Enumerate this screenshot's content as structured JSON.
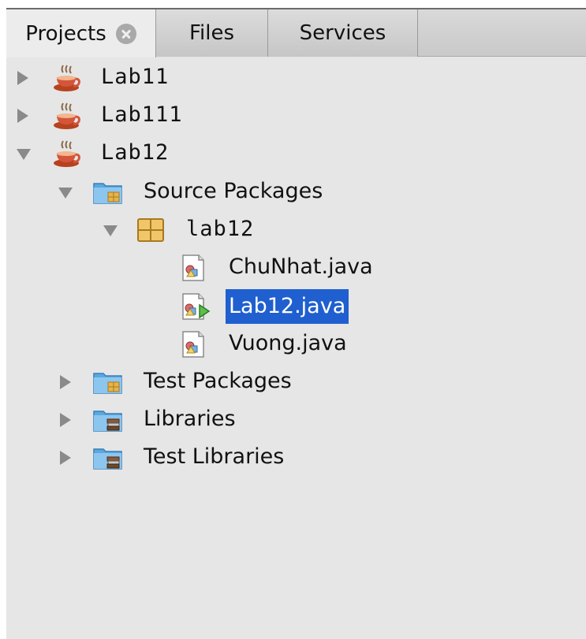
{
  "tabs": [
    {
      "label": "Projects",
      "active": true,
      "has_close": true
    },
    {
      "label": "Files",
      "active": false
    },
    {
      "label": "Services",
      "active": false
    }
  ],
  "tree": {
    "lab11": "Lab11",
    "lab111": "Lab111",
    "lab12": "Lab12",
    "source_packages": "Source Packages",
    "package_lab12": "lab12",
    "file_chunhat": "ChuNhat.java",
    "file_lab12": "Lab12.java",
    "file_vuong": "Vuong.java",
    "test_packages": "Test Packages",
    "libraries": "Libraries",
    "test_libraries": "Test Libraries"
  },
  "selected_item": "Lab12.java",
  "colors": {
    "selection": "#1f5fcf",
    "panel_bg": "#e6e6e6",
    "toggle": "#8a8a8a",
    "folder": "#5aa8e0",
    "package": "#e8b34a",
    "java_cup": "#c0482c"
  },
  "icons": {
    "project": "java-project-cup-icon",
    "source_folder": "source-folder-icon",
    "package": "package-icon",
    "java_file": "java-file-icon",
    "main_class_file": "java-main-class-icon",
    "library": "library-folder-icon"
  }
}
